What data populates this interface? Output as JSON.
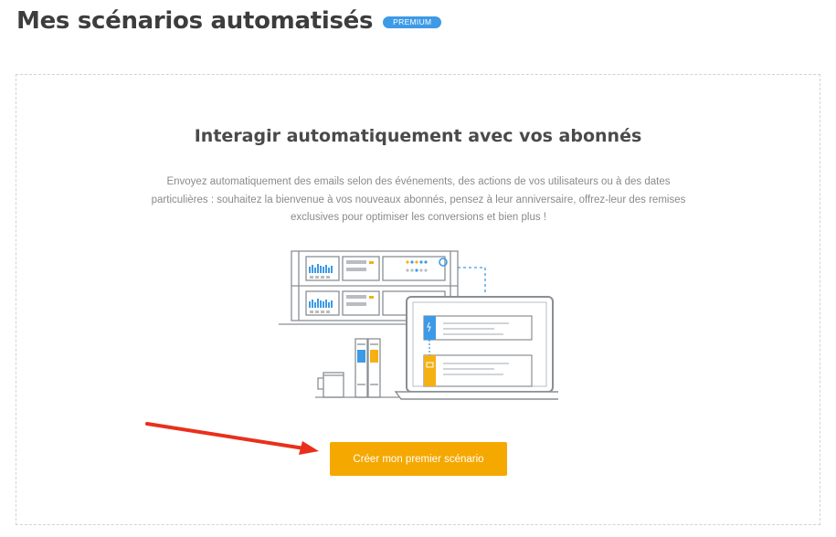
{
  "header": {
    "title": "Mes scénarios automatisés",
    "badge": "PREMIUM"
  },
  "empty_state": {
    "title": "Interagir automatiquement avec vos abonnés",
    "description": "Envoyez automatiquement des emails selon des événements, des actions de vos utilisateurs ou à des dates particulières : souhaitez la bienvenue à vos nouveaux abonnés, pensez à leur anniversaire, offrez-leur des remises exclusives pour optimiser les conversions et bien plus !",
    "cta_label": "Créer mon premier scénario"
  },
  "colors": {
    "accent_orange": "#f5a800",
    "badge_blue": "#3d9ae6",
    "arrow_red": "#e8301c",
    "illustration_blue": "#3d9ae6",
    "illustration_yellow": "#f5b014"
  },
  "illustration": {
    "icon": "servers-laptop-illustration"
  }
}
